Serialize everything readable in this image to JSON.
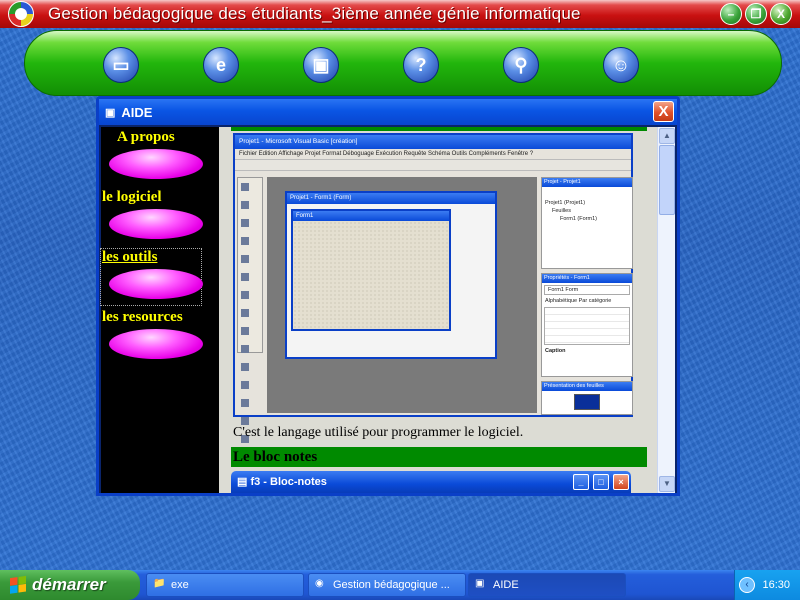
{
  "app": {
    "title": "Gestion bédagogique des étudiants_3ième année génie informatique"
  },
  "toolbar": {
    "icons": [
      "computer-icon",
      "internet-explorer-icon",
      "monitor-icon",
      "help-icon",
      "disconnect-icon",
      "users-icon"
    ]
  },
  "aide": {
    "title": "AIDE",
    "close_label": "X",
    "sidebar": [
      {
        "label": "A propos"
      },
      {
        "label": "le logiciel"
      },
      {
        "label": "les outils"
      },
      {
        "label": "les resources"
      }
    ],
    "screenshot": {
      "title": "Projet1 - Microsoft Visual Basic [création]",
      "menu": "Fichier  Edition  Affichage  Projet  Format  Déboguage  Exécution  Requête  Schéma  Outils  Compléments  Fenêtre  ?",
      "form_window_title": "Projet1 - Form1 (Form)",
      "inner_form_title": "Form1",
      "project_panel_title": "Projet - Projet1",
      "project_items": [
        "Projet1 (Projet1)",
        "Feuilles",
        "Form1 (Form1)"
      ],
      "properties_title": "Propriétés - Form1",
      "properties_combo": "Form1  Form",
      "properties_tabs": "Alphabétique   Par catégorie",
      "caption_label": "Caption",
      "layout_title": "Présentation des feuilles"
    },
    "caption_text": "C'est le langage utilisé pour programmer le logiciel.",
    "section_title": "Le bloc notes",
    "notepad_title": "f3 - Bloc-notes"
  },
  "taskbar": {
    "start_label": "démarrer",
    "tasks": [
      {
        "label": "exe"
      },
      {
        "label": "Gestion bédagogique ..."
      },
      {
        "label": "AIDE"
      }
    ],
    "clock": "16:30"
  }
}
